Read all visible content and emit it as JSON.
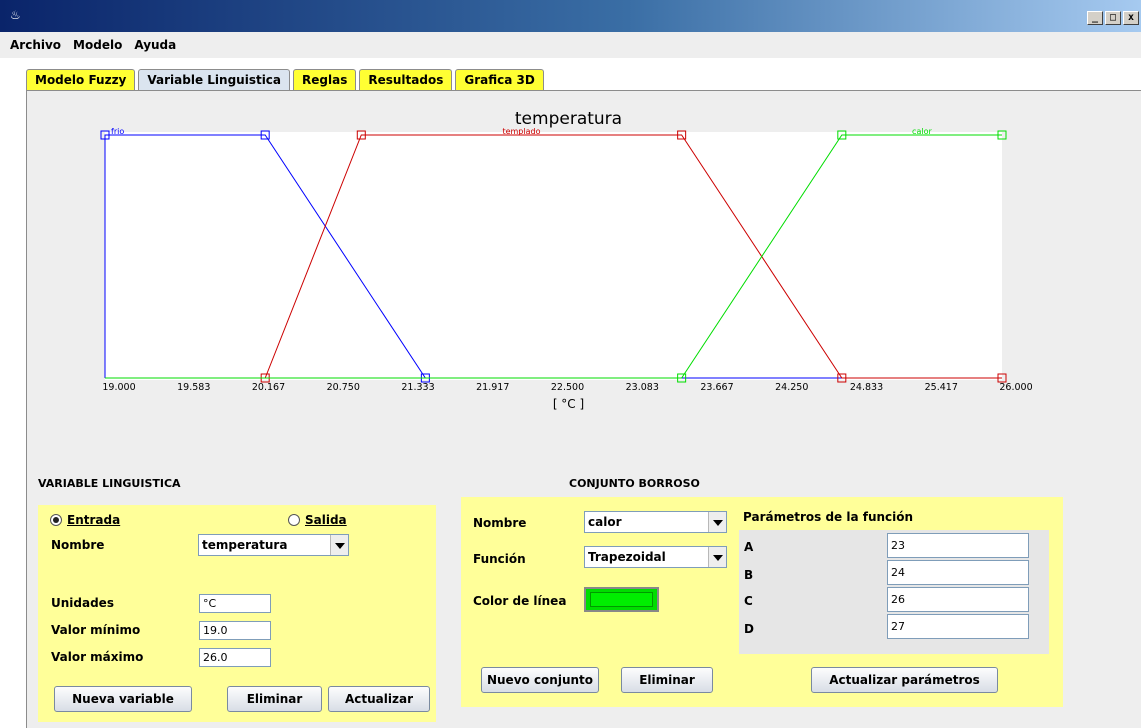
{
  "window": {
    "min": "_",
    "max": "□",
    "close": "x"
  },
  "menu": [
    "Archivo",
    "Modelo",
    "Ayuda"
  ],
  "tabs": [
    "Modelo Fuzzy",
    "Variable Linguistica",
    "Reglas",
    "Resultados",
    "Grafica 3D"
  ],
  "active_tab": "Variable Linguistica",
  "chart_data": {
    "type": "line",
    "title": "temperatura",
    "xlabel": "[ °C ]",
    "xlim": [
      19.0,
      26.0
    ],
    "ylim": [
      0,
      1
    ],
    "xticks": [
      "19.000",
      "19.583",
      "20.167",
      "20.750",
      "21.333",
      "21.917",
      "22.500",
      "23.083",
      "23.667",
      "24.250",
      "24.833",
      "25.417",
      "26.000"
    ],
    "series": [
      {
        "name": "frio",
        "color": "#0000ff",
        "x": [
          19.0,
          19.0,
          20.25,
          21.5,
          26.0
        ],
        "y": [
          0,
          1,
          1,
          0,
          0
        ]
      },
      {
        "name": "templado",
        "color": "#cc0000",
        "x": [
          19.0,
          20.25,
          21.0,
          23.5,
          24.75,
          26.0
        ],
        "y": [
          0,
          0,
          1,
          1,
          0,
          0
        ]
      },
      {
        "name": "calor",
        "color": "#00dd00",
        "x": [
          19.0,
          23.5,
          24.75,
          26.0
        ],
        "y": [
          0,
          0,
          1,
          1
        ]
      }
    ]
  },
  "variable": {
    "section_title": "VARIABLE LINGUISTICA",
    "entrada": "Entrada",
    "salida": "Salida",
    "nombre_label": "Nombre",
    "nombre_value": "temperatura",
    "unidades_label": "Unidades",
    "unidades_value": "°C",
    "min_label": "Valor mínimo",
    "min_value": "19.0",
    "max_label": "Valor máximo",
    "max_value": "26.0",
    "btn_nueva": "Nueva variable",
    "btn_eliminar": "Eliminar",
    "btn_actualizar": "Actualizar"
  },
  "conjunto": {
    "section_title": "CONJUNTO BORROSO",
    "nombre_label": "Nombre",
    "nombre_value": "calor",
    "funcion_label": "Función",
    "funcion_value": "Trapezoidal",
    "color_label": "Color de línea",
    "line_color": "#00ee00",
    "params_title": "Parámetros de la función",
    "params": [
      {
        "label": "A",
        "value": "23"
      },
      {
        "label": "B",
        "value": "24"
      },
      {
        "label": "C",
        "value": "26"
      },
      {
        "label": "D",
        "value": "27"
      }
    ],
    "btn_nuevo": "Nuevo conjunto",
    "btn_eliminar": "Eliminar",
    "btn_actualizar": "Actualizar parámetros"
  }
}
